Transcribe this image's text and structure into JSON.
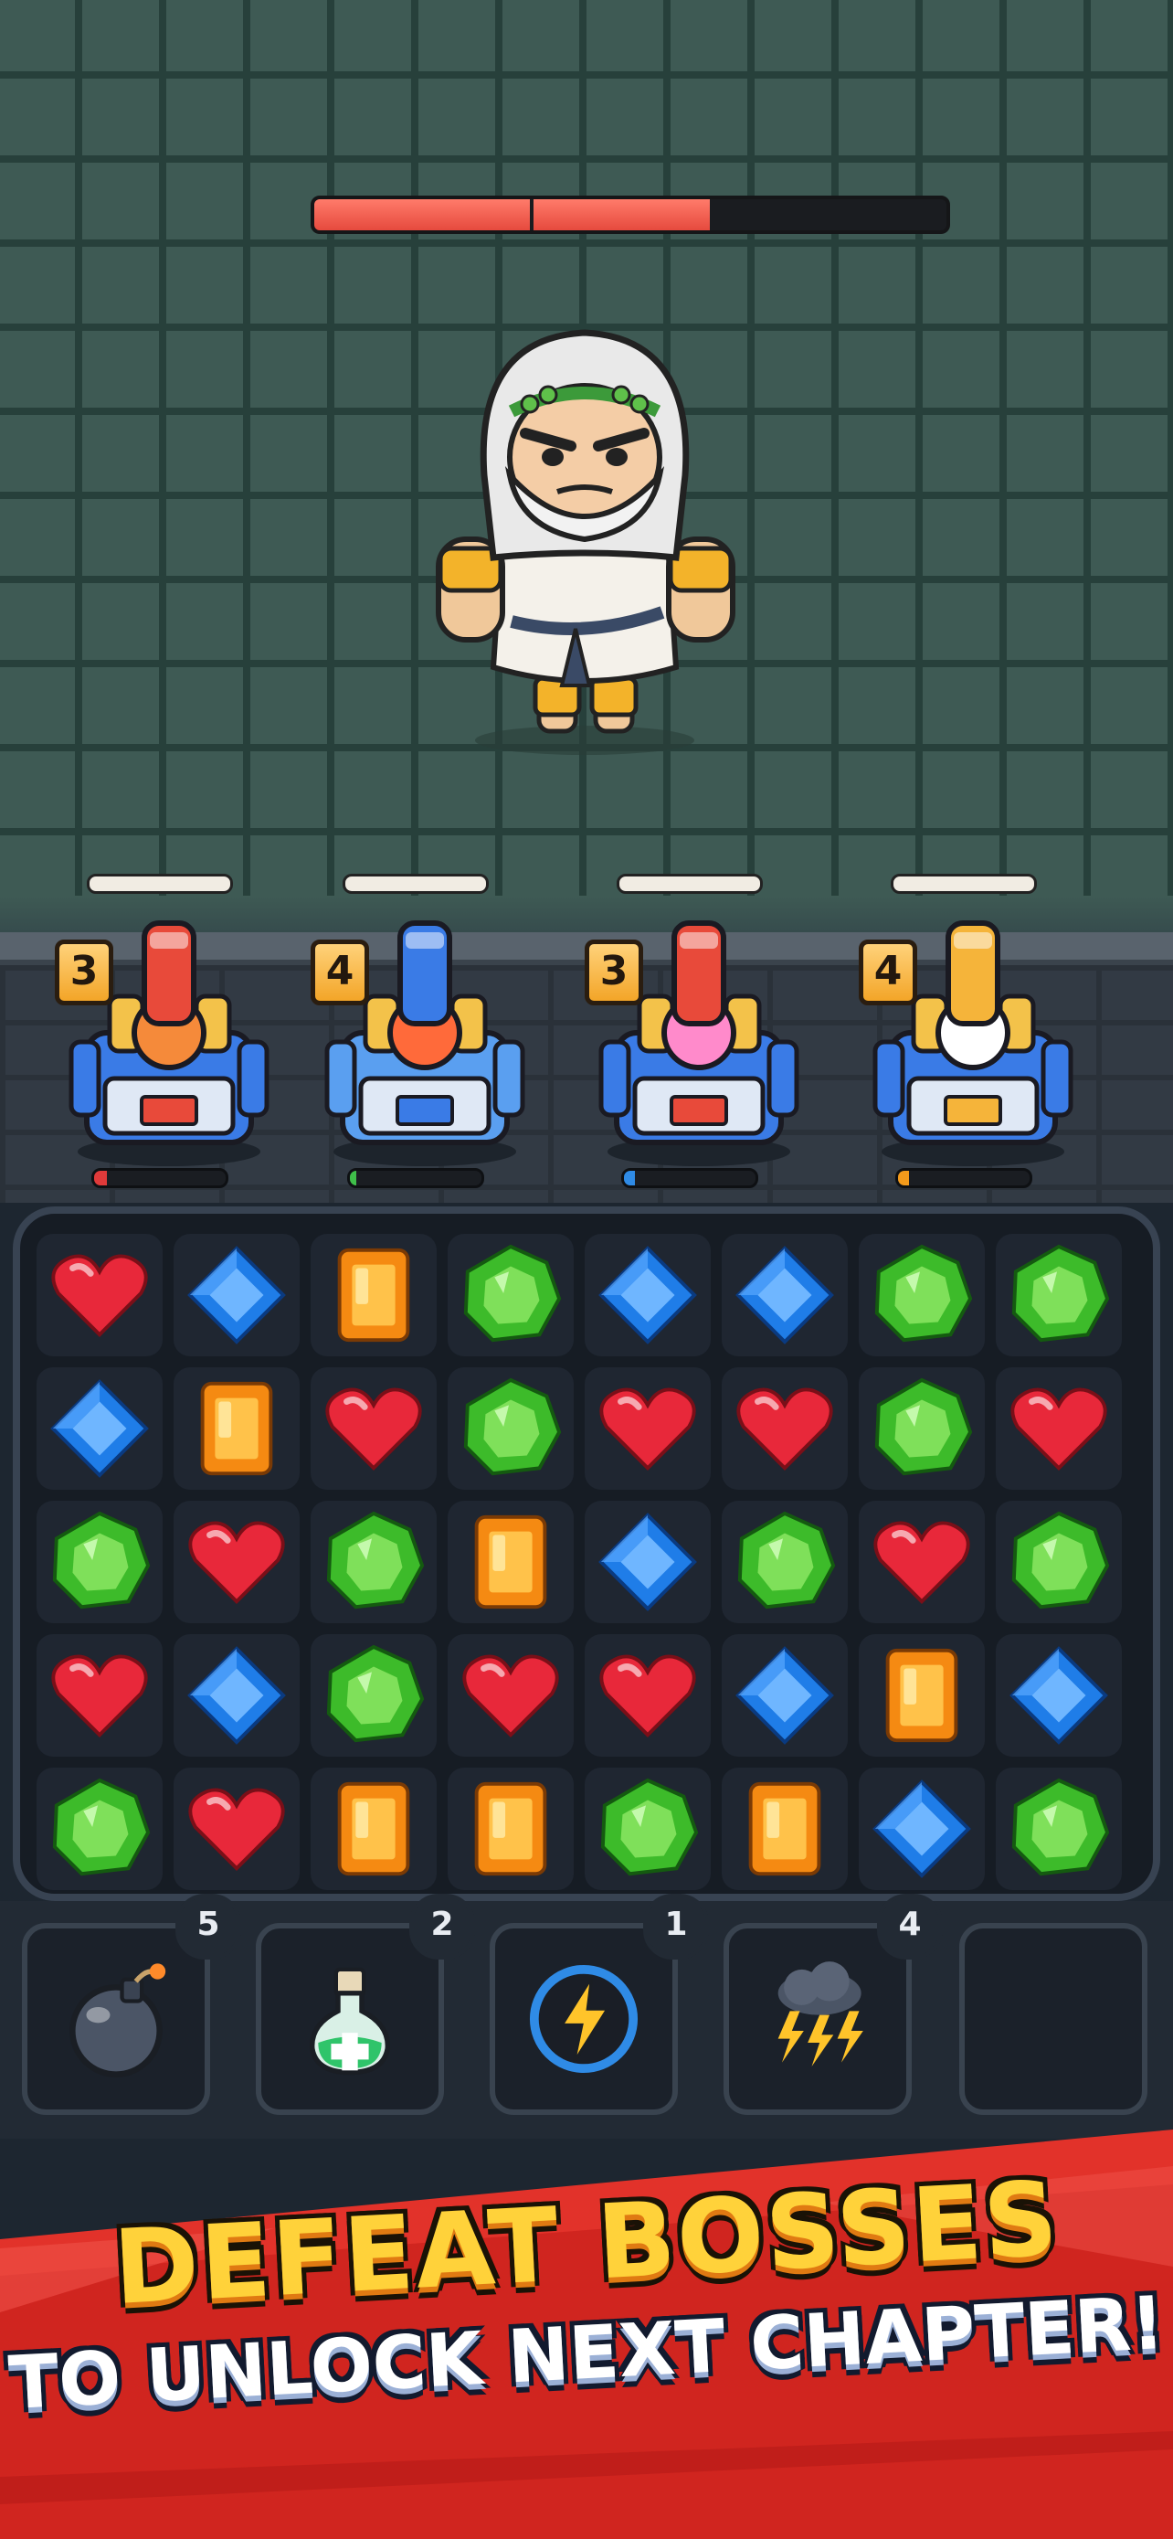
{
  "boss": {
    "name_icon": "bearded-elder-god-boss",
    "health_fraction": 0.625
  },
  "towers": [
    {
      "level": "3",
      "icon": "red-turret-tower",
      "charge_fraction": 0.1,
      "charge_color": "#e03a3a"
    },
    {
      "level": "4",
      "icon": "blue-cannon-tower",
      "charge_fraction": 0.05,
      "charge_color": "#3fbf4a"
    },
    {
      "level": "3",
      "icon": "pink-turret-tower",
      "charge_fraction": 0.08,
      "charge_color": "#2f8be6"
    },
    {
      "level": "4",
      "icon": "yellow-cannon-tower",
      "charge_fraction": 0.08,
      "charge_color": "#f39a1b"
    }
  ],
  "board": {
    "rows": [
      [
        "heart",
        "blue",
        "orange",
        "green",
        "blue",
        "blue",
        "green",
        "green"
      ],
      [
        "blue",
        "orange",
        "heart",
        "green",
        "heart",
        "heart",
        "green",
        "heart"
      ],
      [
        "green",
        "heart",
        "green",
        "orange",
        "blue",
        "green",
        "heart",
        "green"
      ],
      [
        "heart",
        "blue",
        "green",
        "heart",
        "heart",
        "blue",
        "orange",
        "blue"
      ],
      [
        "green",
        "heart",
        "orange",
        "orange",
        "green",
        "orange",
        "blue",
        "green"
      ]
    ]
  },
  "powerups": [
    {
      "icon": "bomb-icon",
      "count": "5"
    },
    {
      "icon": "potion-icon",
      "count": "2"
    },
    {
      "icon": "lightning-icon",
      "count": "1"
    },
    {
      "icon": "storm-cloud-icon",
      "count": "4"
    },
    {
      "icon": "empty-slot",
      "count": ""
    }
  ],
  "banner": {
    "line1": "DEFEAT BOSSES",
    "line2": "TO UNLOCK NEXT CHAPTER!"
  },
  "colors": {
    "heart": "#e8283a",
    "blue": "#1f7de8",
    "orange": "#f58a12",
    "green": "#3dbb2a",
    "banner_red": "#e2322a"
  }
}
